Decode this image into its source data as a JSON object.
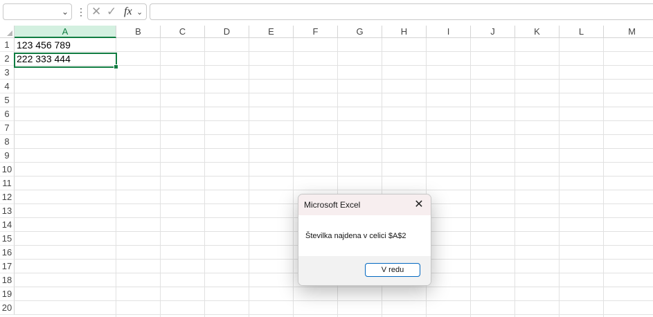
{
  "formula_bar": {
    "name_box_value": "",
    "formula_value": ""
  },
  "columns": [
    "A",
    "B",
    "C",
    "D",
    "E",
    "F",
    "G",
    "H",
    "I",
    "J",
    "K",
    "L",
    "M"
  ],
  "selected_column": "A",
  "rows": [
    "1",
    "2",
    "3",
    "4",
    "5",
    "6",
    "7",
    "8",
    "9",
    "10",
    "11",
    "12",
    "13",
    "14",
    "15",
    "16",
    "17",
    "18",
    "19",
    "20"
  ],
  "cells": {
    "A1": "123 456 789",
    "A2": "222 333 444"
  },
  "dialog": {
    "title": "Microsoft Excel",
    "message": "Številka najdena v celici $A$2",
    "ok_label": "V redu"
  },
  "colors": {
    "accent": "#107c41",
    "button_border": "#0067c0"
  }
}
